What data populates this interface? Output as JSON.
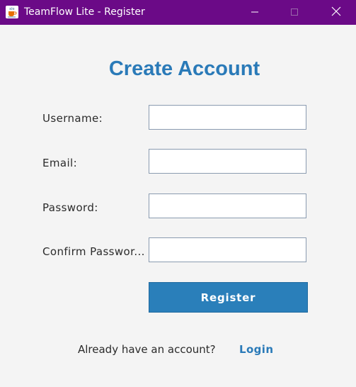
{
  "window": {
    "title": "TeamFlow Lite - Register",
    "app_icon": "java-cup-icon",
    "controls": {
      "minimize_icon": "minimize-icon",
      "maximize_icon": "maximize-icon",
      "close_icon": "close-icon"
    },
    "titlebar_color": "#6b0a87"
  },
  "form": {
    "heading": "Create Account",
    "fields": [
      {
        "label": "Username:",
        "value": ""
      },
      {
        "label": "Email:",
        "value": ""
      },
      {
        "label": "Password:",
        "value": ""
      },
      {
        "label": "Confirm Passwor...",
        "value": ""
      }
    ],
    "register_label": "Register",
    "accent_color": "#2a7ab8"
  },
  "footer": {
    "prompt": "Already have an account?",
    "login_label": "Login"
  }
}
